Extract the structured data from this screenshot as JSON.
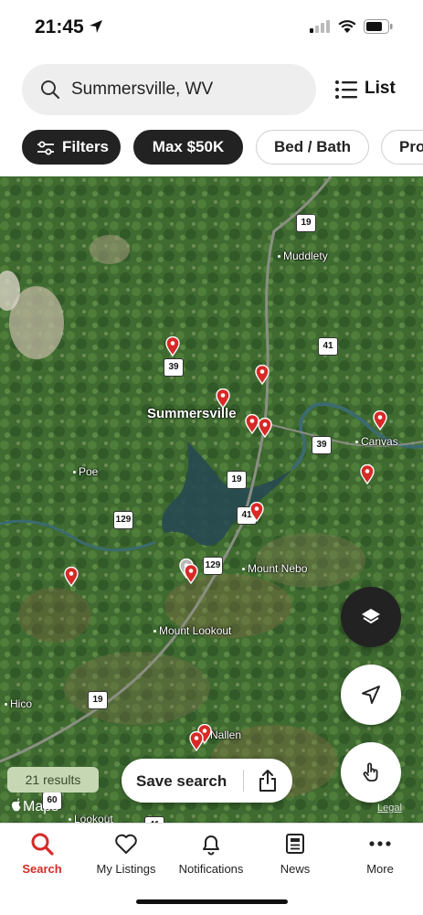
{
  "status": {
    "time": "21:45"
  },
  "search": {
    "query": "Summersville, WV"
  },
  "list_button": {
    "label": "List"
  },
  "chips": {
    "filters": "Filters",
    "max_price": "Max $50K",
    "bed_bath": "Bed / Bath",
    "property": "Pro"
  },
  "map": {
    "places": {
      "summersville": "Summersville",
      "muddlety": "Muddlety",
      "canvas": "Canvas",
      "poe": "Poe",
      "mount_nebo": "Mount Nebo",
      "mount_lookout": "Mount Lookout",
      "nallen": "Nallen",
      "hico": "Hico",
      "lookout": "Lookout"
    },
    "routes": {
      "r19a": "19",
      "r19b": "19",
      "r19c": "19",
      "r41a": "41",
      "r41b": "41",
      "r41c": "41",
      "r39a": "39",
      "r39b": "39",
      "r129a": "129",
      "r129b": "129",
      "r60": "60"
    },
    "pin_color": "#d62a27"
  },
  "results": {
    "count_label": "21 results"
  },
  "save_search": {
    "label": "Save search"
  },
  "attribution": {
    "maps": "Maps",
    "legal": "Legal"
  },
  "tabs": {
    "search": "Search",
    "my_listings": "My Listings",
    "notifications": "Notifications",
    "news": "News",
    "more": "More"
  }
}
